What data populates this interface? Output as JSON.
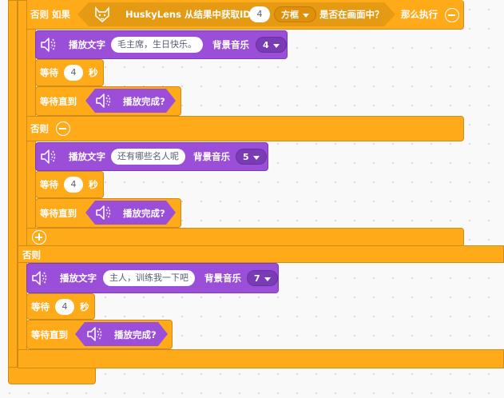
{
  "outer_else_if": {
    "else_if_label": "否则 如果",
    "husky_text": "HuskyLens 从结果中获取ID",
    "id_value": "4",
    "type_option": "方框",
    "in_frame_text": "是否在画面中？",
    "then_label": "那么执行"
  },
  "block1": {
    "play_text_label": "播放文字",
    "text_value": "毛主席，生日快乐。",
    "bgm_label": "背景音乐",
    "bgm_value": "4",
    "wait_label": "等待",
    "wait_value": "4",
    "seconds_label": "秒",
    "wait_until_label": "等待直到",
    "play_done_label": "播放完成?"
  },
  "inner_else": {
    "label": "否则"
  },
  "block2": {
    "play_text_label": "播放文字",
    "text_value": "还有哪些名人呢",
    "bgm_label": "背景音乐",
    "bgm_value": "5",
    "wait_label": "等待",
    "wait_value": "4",
    "seconds_label": "秒",
    "wait_until_label": "等待直到",
    "play_done_label": "播放完成?"
  },
  "outer_else": {
    "label": "否则"
  },
  "block3": {
    "play_text_label": "播放文字",
    "text_value": "主人，训练我一下吧",
    "bgm_label": "背景音乐",
    "bgm_value": "7",
    "wait_label": "等待",
    "wait_value": "4",
    "seconds_label": "秒",
    "wait_until_label": "等待直到",
    "play_done_label": "播放完成?"
  },
  "colors": {
    "control": "#ffab19",
    "sound": "#9b4fd9",
    "condition": "#e59a14"
  },
  "icons": [
    "speaker-icon",
    "husky-lens-fox-icon",
    "minus-circle-icon",
    "plus-circle-icon",
    "caret-down-icon"
  ]
}
